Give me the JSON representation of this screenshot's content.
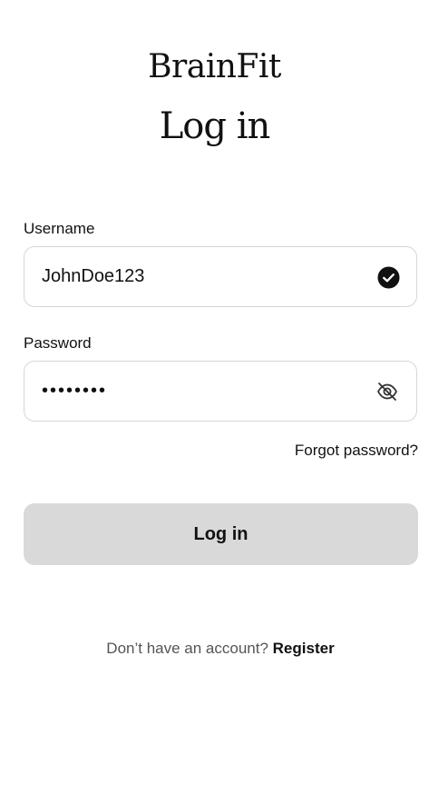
{
  "header": {
    "brand": "BrainFit",
    "title": "Log in"
  },
  "form": {
    "username": {
      "label": "Username",
      "value": "JohnDoe123",
      "status_icon": "check-circle-icon"
    },
    "password": {
      "label": "Password",
      "value": "password",
      "toggle_icon": "eye-off-icon"
    },
    "forgot_label": "Forgot password?",
    "submit_label": "Log in"
  },
  "footer": {
    "prompt": "Don’t have an account?",
    "register_label": "Register"
  },
  "colors": {
    "button_bg": "#d9d9d9",
    "border": "#d6d6d6",
    "text": "#111111",
    "muted": "#555555"
  }
}
